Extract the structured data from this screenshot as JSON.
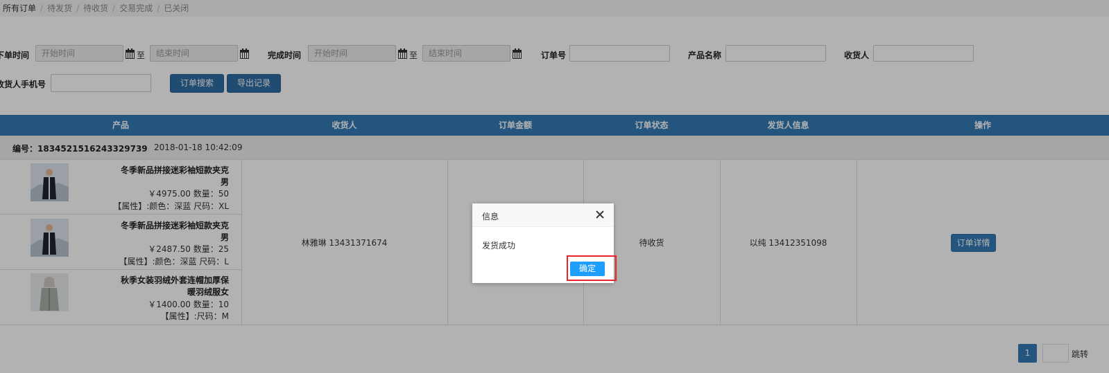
{
  "tabs": [
    "所有订单",
    "待发货",
    "待收货",
    "交易完成",
    "已关闭"
  ],
  "filters": {
    "order_time_label": "下单时间",
    "finish_time_label": "完成时间",
    "start_placeholder": "开始时间",
    "end_placeholder": "结束时间",
    "to_label": "至",
    "order_no_label": "订单号",
    "product_name_label": "产品名称",
    "receiver_label": "收货人",
    "receiver_phone_label": "收货人手机号",
    "search_button": "订单搜索",
    "export_button": "导出记录"
  },
  "table": {
    "headers": [
      "产品",
      "收货人",
      "订单金额",
      "订单状态",
      "发货人信息",
      "操作"
    ],
    "order": {
      "number": "编号：1834521516243329739",
      "date": "2018-01-18 10:42:09",
      "products": [
        {
          "name_line1": "冬季新品拼接迷彩袖短款夹克",
          "name_line2": "男",
          "price_qty": "￥4975.00 数量：50",
          "attrs": "【属性】:颜色：深蓝 尺码：XL"
        },
        {
          "name_line1": "冬季新品拼接迷彩袖短款夹克",
          "name_line2": "男",
          "price_qty": "￥2487.50 数量：25",
          "attrs": "【属性】:颜色：深蓝 尺码：L"
        },
        {
          "name_line1": "秋季女装羽绒外套连帽加厚保",
          "name_line2": "暖羽绒服女",
          "price_qty": "￥1400.00 数量：10",
          "attrs": "【属性】:尺码：M"
        }
      ],
      "receiver": "林雅琳 13431371674",
      "status": "待收货",
      "shipper": "以纯 13412351098",
      "detail_button": "订单详情"
    }
  },
  "pagination": {
    "current": "1",
    "jump_label": "跳转"
  },
  "dialog": {
    "title": "信息",
    "message": "发货成功",
    "ok_button": "确定"
  }
}
